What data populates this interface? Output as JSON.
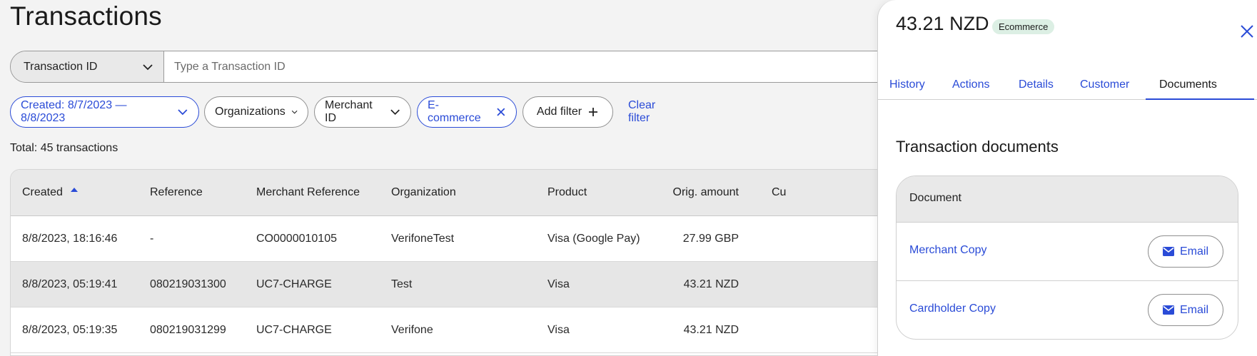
{
  "page": {
    "title": "Transactions"
  },
  "search": {
    "type_label": "Transaction ID",
    "placeholder": "Type a Transaction ID"
  },
  "filters": {
    "created": "Created: 8/7/2023 — 8/8/2023",
    "organizations": "Organizations",
    "merchant_id": "Merchant ID",
    "ecommerce": "E-commerce",
    "add_filter": "Add filter",
    "clear_filter": "Clear filter"
  },
  "total": "Total: 45 transactions",
  "table": {
    "columns": [
      "Created",
      "Reference",
      "Merchant Reference",
      "Organization",
      "Product",
      "Orig. amount",
      "Cu"
    ],
    "rows": [
      [
        "8/8/2023, 18:16:46",
        "-",
        "CO0000010105",
        "VerifoneTest",
        "Visa (Google Pay)",
        "27.99 GBP"
      ],
      [
        "8/8/2023, 05:19:41",
        "080219031300",
        "UC7-CHARGE",
        "Test",
        "Visa",
        "43.21 NZD"
      ],
      [
        "8/8/2023, 05:19:35",
        "080219031299",
        "UC7-CHARGE",
        "Verifone",
        "Visa",
        "43.21 NZD"
      ]
    ]
  },
  "panel": {
    "amount": "43.21 NZD",
    "badge": "Ecommerce",
    "tabs": [
      "History",
      "Actions",
      "Details",
      "Customer",
      "Documents"
    ],
    "active_tab": "Documents",
    "documents_title": "Transaction documents",
    "documents_header": "Document",
    "documents": [
      {
        "name": "Merchant Copy",
        "action": "Email"
      },
      {
        "name": "Cardholder Copy",
        "action": "Email"
      }
    ]
  },
  "colors": {
    "accent": "#2a4bd7",
    "badge_bg": "#dcefe4"
  }
}
